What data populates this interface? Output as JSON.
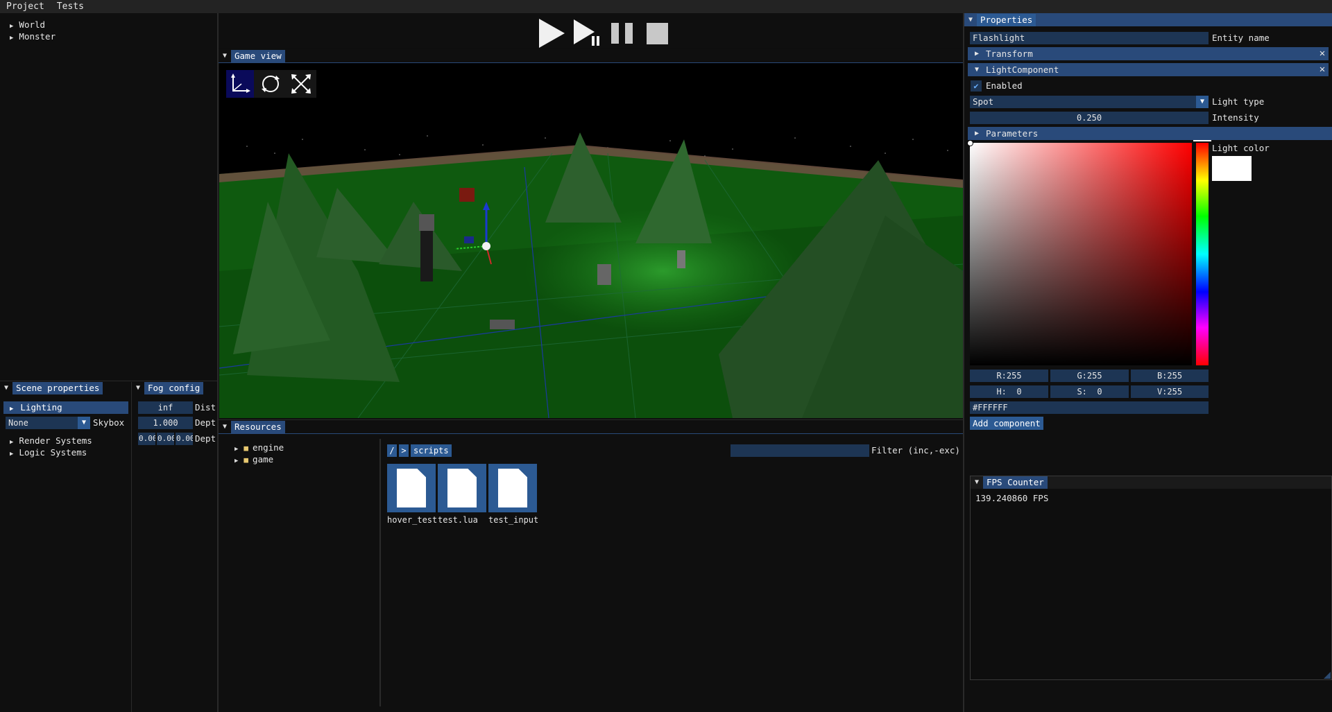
{
  "menu": [
    "Project",
    "Tests"
  ],
  "scene_tree": [
    "World",
    "Monster"
  ],
  "scene_properties": {
    "title": "Scene properties",
    "lighting": "Lighting",
    "skybox_value": "None",
    "skybox_label": "Skybox",
    "render_systems": "Render Systems",
    "logic_systems": "Logic Systems"
  },
  "fog": {
    "title": "Fog config",
    "dist_value": "inf",
    "dist_label": "Dist",
    "depth_value": "1.000",
    "depth_label": "Dept",
    "color_values": [
      "0.00",
      "0.00",
      "0.00"
    ],
    "color_label": "Dept"
  },
  "game_view": {
    "title": "Game view"
  },
  "resources": {
    "title": "Resources",
    "folders": [
      "engine",
      "game"
    ],
    "breadcrumb_root": "/",
    "breadcrumb_sep": ">",
    "breadcrumb_current": "scripts",
    "filter_label": "Filter (inc,-exc)",
    "files": [
      "hover_test",
      "test.lua",
      "test_input"
    ]
  },
  "properties": {
    "title": "Properties",
    "entity_name_value": "Flashlight",
    "entity_name_label": "Entity name",
    "transform": "Transform",
    "light_component": "LightComponent",
    "enabled": "Enabled",
    "light_type_value": "Spot",
    "light_type_label": "Light type",
    "intensity_value": "0.250",
    "intensity_label": "Intensity",
    "parameters": "Parameters",
    "light_color_label": "Light color",
    "r": "R:255",
    "g": "G:255",
    "b": "B:255",
    "h": "H:  0",
    "s": "S:  0",
    "v": "V:255",
    "hex": "#FFFFFF",
    "add_component": "Add component"
  },
  "fps": {
    "title": "FPS Counter",
    "value": "139.240860 FPS"
  },
  "colors": {
    "accent": "#294a7a",
    "button": "#2c5a93",
    "field": "#1d3554"
  }
}
